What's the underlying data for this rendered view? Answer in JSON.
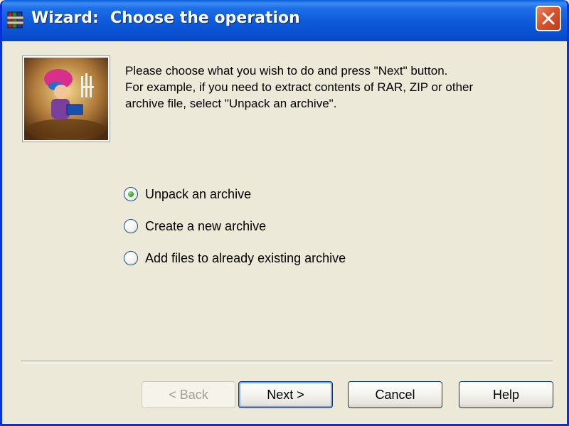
{
  "window": {
    "title_prefix": "Wizard:",
    "title_main": "Choose the operation",
    "app_icon": "winrar-books-icon",
    "close_icon": "close-icon"
  },
  "intro": {
    "line1": "Please choose what you wish to do and press \"Next\" button.",
    "line2": "For example, if you need to extract contents of RAR, ZIP or other",
    "line3": "archive file, select \"Unpack an archive\"."
  },
  "options": [
    {
      "label": "Unpack an archive",
      "selected": true
    },
    {
      "label": "Create a new archive",
      "selected": false
    },
    {
      "label": "Add files to already existing archive",
      "selected": false
    }
  ],
  "buttons": {
    "back": "< Back",
    "next": "Next >",
    "cancel": "Cancel",
    "help": "Help"
  }
}
